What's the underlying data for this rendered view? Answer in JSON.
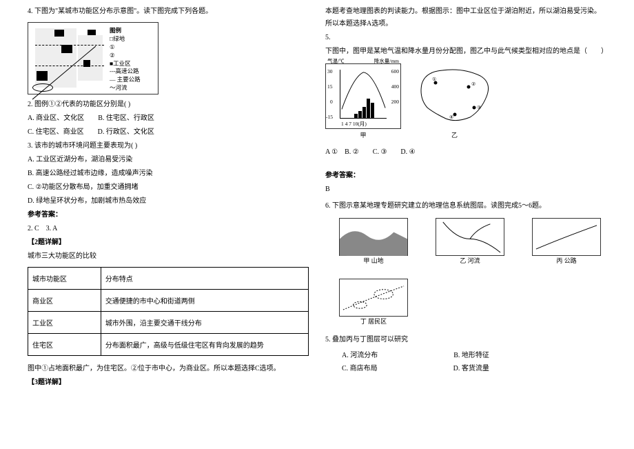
{
  "left": {
    "q4_intro": "4. 下图为\"某城市功能区分布示意图\"。读下图完成下列各题。",
    "legend": {
      "title": "图例",
      "lvdi": "□绿地",
      "n1": "①",
      "n2": "②",
      "gyq": "■工业区",
      "gsgl": "---高速公路",
      "zygl": "— 主要公路",
      "hl": "～河流"
    },
    "q2_stem": "2. 图例①②代表的功能区分别是(   )",
    "q2_a": "A. 商业区、文化区　　B. 住宅区、行政区",
    "q2_c": "C. 住宅区、商业区　　D. 行政区、文化区",
    "q3_stem": "3. 该市的城市环境问题主要表现为(   )",
    "q3_a": "A. 工业区近湖分布，湖泊易受污染",
    "q3_b": "B. 高速公路经过城市边缘，造成噪声污染",
    "q3_c": "C. ②功能区分散布局，加重交通拥堵",
    "q3_d": "D. 绿地呈环状分布，加剧城市热岛效应",
    "ans_title": "参考答案：",
    "ans_23": "2. C　3. A",
    "exp2_title": "【2题详解】",
    "exp2_intro": "城市三大功能区的比较",
    "th1": "城市功能区",
    "th2": "分布特点",
    "r1c1": "商业区",
    "r1c2": "交通便捷的市中心和街道两侧",
    "r2c1": "工业区",
    "r2c2": "城市外围，沿主要交通干线分布",
    "r3c1": "住宅区",
    "r3c2": "分布面积最广，高级与低级住宅区有背向发展的趋势",
    "exp2_end": "图中①占地面积最广，为住宅区。②位于市中心，为商业区。所以本题选择C选项。",
    "exp3_title": "【3题详解】"
  },
  "right": {
    "q3_expl": "本题考查地理图表的判读能力。根据图示：图中工业区位于湖泊附近，所以湖泊易受污染。所以本题选择A选项。",
    "q5_num": "5.",
    "q5_stem": "下图中，图甲是某地气温和降水量月份分配图，图乙中与此气候类型相对应的地点是（　　）",
    "axis_temp": "气温/℃",
    "axis_rain": "降水量/mm",
    "t30": "30",
    "t15": "15",
    "t0": "0",
    "tm15": "-15",
    "r600": "600",
    "r400": "400",
    "r200": "200",
    "mon": "1 4 7 10(月)",
    "cap_jia": "甲",
    "cap_yi": "乙",
    "q5_opts": "A ①　B. ②　　C. ③　　D. ④",
    "ans_title": "参考答案：",
    "ans5": "B",
    "q6_stem": "6. 下图示意某地理专题研究建立的地理信息系统图层。读图完成5～6题。",
    "layer_a": "甲 山地",
    "layer_b": "乙 河流",
    "layer_c": "丙 公路",
    "layer_d": "丁 居民区",
    "q6_sub": "5. 叠加丙与丁图层可以研究",
    "oA": "A. 河流分布",
    "oB": "B. 地形特征",
    "oC": "C. 商店布局",
    "oD": "D. 客货流量"
  },
  "chart_data": {
    "type": "bar_line_combo",
    "title": "某地气温和降水量月份分配图",
    "x": [
      1,
      2,
      3,
      4,
      5,
      6,
      7,
      8,
      9,
      10,
      11,
      12
    ],
    "xlabel": "月",
    "series": [
      {
        "name": "气温/℃",
        "type": "line",
        "yaxis": "left",
        "values": [
          -10,
          -6,
          2,
          12,
          20,
          26,
          29,
          28,
          22,
          12,
          2,
          -8
        ]
      },
      {
        "name": "降水量/mm",
        "type": "bar",
        "yaxis": "right",
        "values": [
          5,
          8,
          15,
          30,
          55,
          95,
          190,
          170,
          70,
          30,
          15,
          8
        ]
      }
    ],
    "y_left": {
      "label": "气温/℃",
      "ticks": [
        -15,
        0,
        15,
        30
      ]
    },
    "y_right": {
      "label": "降水量/mm",
      "ticks": [
        0,
        200,
        400,
        600
      ]
    }
  }
}
